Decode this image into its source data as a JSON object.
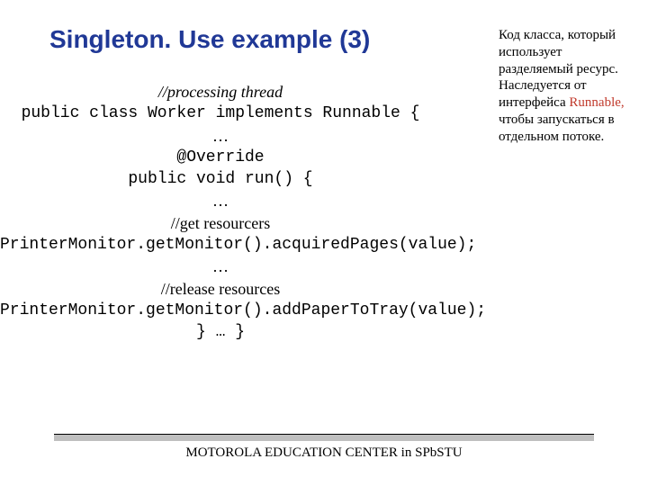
{
  "title": "Singleton. Use example (3)",
  "sidebar": {
    "part1": "Код класса, который использует разделяемый ресурс. Наследуется от интерфейса ",
    "highlight": "Runnable,",
    "part2": " чтобы запускаться в отдельном потоке."
  },
  "code": {
    "l1": "//processing thread",
    "l2": "public class Worker implements Runnable {",
    "l3": "…",
    "l4": "@Override",
    "l5": "public void run() {",
    "l6": "…",
    "l7": "//get resourcers",
    "l8": "PrinterMonitor.getMonitor().acquiredPages(value);",
    "l9": "…",
    "l10": "//release resources",
    "l11": "PrinterMonitor.getMonitor().addPaperToTray(value);",
    "l12": "} … }"
  },
  "footer": "MOTOROLA EDUCATION CENTER in SPbSTU"
}
